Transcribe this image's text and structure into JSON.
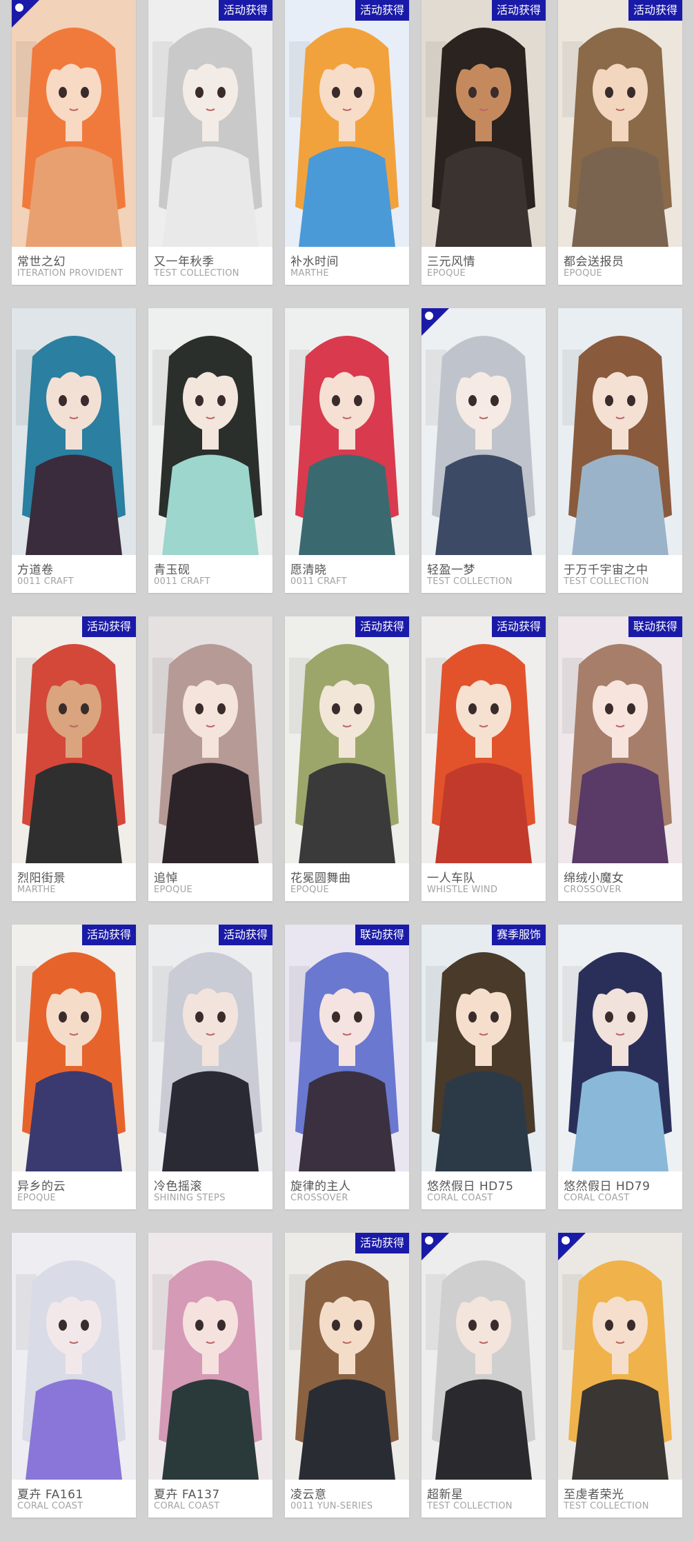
{
  "badges": {
    "event": "活动获得",
    "collab": "联动获得",
    "season": "赛季服饰"
  },
  "rows": [
    [
      {
        "name": "常世之幻",
        "series": "ITERATION PROVIDENT",
        "badge": "",
        "corner": true,
        "bg": "#f2d2b8",
        "hair": "#f07a3c",
        "skin": "#f7d9c4",
        "cloth": "#e8a070"
      },
      {
        "name": "又一年秋季",
        "series": "TEST COLLECTION",
        "badge": "活动获得",
        "corner": false,
        "bg": "#eeeeee",
        "hair": "#c9c9c9",
        "skin": "#f3ece6",
        "cloth": "#e9e9e9"
      },
      {
        "name": "补水时间",
        "series": "MARTHE",
        "badge": "活动获得",
        "corner": false,
        "bg": "#e7eef7",
        "hair": "#f2a23c",
        "skin": "#f7dcc8",
        "cloth": "#4a9ad8"
      },
      {
        "name": "三元风情",
        "series": "EPOQUE",
        "badge": "活动获得",
        "corner": false,
        "bg": "#e2dbd2",
        "hair": "#2a231f",
        "skin": "#c48a5e",
        "cloth": "#3a3330"
      },
      {
        "name": "都会送报员",
        "series": "EPOQUE",
        "badge": "活动获得",
        "corner": false,
        "bg": "#ece6dd",
        "hair": "#8a6a48",
        "skin": "#f2d6bd",
        "cloth": "#7a6450"
      }
    ],
    [
      {
        "name": "方道卷",
        "series": "0011 CRAFT",
        "badge": "",
        "corner": false,
        "bg": "#dfe5e8",
        "hair": "#2b7fa0",
        "skin": "#f3e0d4",
        "cloth": "#3a2c3c"
      },
      {
        "name": "青玉砚",
        "series": "0011 CRAFT",
        "badge": "",
        "corner": false,
        "bg": "#eef0ef",
        "hair": "#2a2f2c",
        "skin": "#f3e6dc",
        "cloth": "#9cd6cc"
      },
      {
        "name": "愿清晓",
        "series": "0011 CRAFT",
        "badge": "",
        "corner": false,
        "bg": "#eef0ef",
        "hair": "#d93a4e",
        "skin": "#f6e0d3",
        "cloth": "#3a6a70"
      },
      {
        "name": "轻盈一梦",
        "series": "TEST COLLECTION",
        "badge": "",
        "corner": true,
        "bg": "#edf0f2",
        "hair": "#bfc4cc",
        "skin": "#f5ebe4",
        "cloth": "#3d4a66"
      },
      {
        "name": "于万千宇宙之中",
        "series": "TEST COLLECTION",
        "badge": "",
        "corner": false,
        "bg": "#e9eef2",
        "hair": "#8a5a3c",
        "skin": "#f4e1d4",
        "cloth": "#9bb3c8"
      }
    ],
    [
      {
        "name": "烈阳街景",
        "series": "MARTHE",
        "badge": "活动获得",
        "corner": false,
        "bg": "#f1eeea",
        "hair": "#d4483a",
        "skin": "#d9a47e",
        "cloth": "#2f2f2f"
      },
      {
        "name": "追悼",
        "series": "EPOQUE",
        "badge": "",
        "corner": false,
        "bg": "#e5e1e0",
        "hair": "#b69a96",
        "skin": "#f4e4dc",
        "cloth": "#2c2428"
      },
      {
        "name": "花冕圆舞曲",
        "series": "EPOQUE",
        "badge": "活动获得",
        "corner": false,
        "bg": "#eeeeea",
        "hair": "#9ca66a",
        "skin": "#f2e6d8",
        "cloth": "#3a3a3a"
      },
      {
        "name": "一人车队",
        "series": "WHISTLE WIND",
        "badge": "活动获得",
        "corner": false,
        "bg": "#f0eeec",
        "hair": "#e2532c",
        "skin": "#f6e1d0",
        "cloth": "#c23a2c"
      },
      {
        "name": "绵绒小魔女",
        "series": "CROSSOVER",
        "badge": "联动获得",
        "corner": false,
        "bg": "#efe7ea",
        "hair": "#a67e6a",
        "skin": "#f7e4dc",
        "cloth": "#5a3a66"
      }
    ],
    [
      {
        "name": "异乡的云",
        "series": "EPOQUE",
        "badge": "活动获得",
        "corner": false,
        "bg": "#f0efec",
        "hair": "#e6642c",
        "skin": "#f5dcc8",
        "cloth": "#3a3a70"
      },
      {
        "name": "冷色摇滚",
        "series": "SHINING STEPS",
        "badge": "活动获得",
        "corner": false,
        "bg": "#ecedef",
        "hair": "#c9ccd4",
        "skin": "#f2e4dc",
        "cloth": "#2a2a34"
      },
      {
        "name": "旋律的主人",
        "series": "CROSSOVER",
        "badge": "联动获得",
        "corner": false,
        "bg": "#e9e6f2",
        "hair": "#6a78d0",
        "skin": "#f4e3e0",
        "cloth": "#3a3040"
      },
      {
        "name": "悠然假日 HD75",
        "series": "CORAL COAST",
        "badge": "赛季服饰",
        "corner": false,
        "bg": "#e6ecf0",
        "hair": "#4a3a2a",
        "skin": "#f5dfcc",
        "cloth": "#2c3a48"
      },
      {
        "name": "悠然假日 HD79",
        "series": "CORAL COAST",
        "badge": "",
        "corner": false,
        "bg": "#eef1f3",
        "hair": "#2a2f5a",
        "skin": "#f2e2dc",
        "cloth": "#8ab8d8"
      }
    ],
    [
      {
        "name": "夏卉 FA161",
        "series": "CORAL COAST",
        "badge": "",
        "corner": false,
        "bg": "#eeedf2",
        "hair": "#d9dbe6",
        "skin": "#f2e8ea",
        "cloth": "#8a76d8"
      },
      {
        "name": "夏卉 FA137",
        "series": "CORAL COAST",
        "badge": "",
        "corner": false,
        "bg": "#efe8ea",
        "hair": "#d49ab6",
        "skin": "#f5e2de",
        "cloth": "#2a3a3a"
      },
      {
        "name": "凌云意",
        "series": "0011 YUN-SERIES",
        "badge": "活动获得",
        "corner": false,
        "bg": "#ecebe8",
        "hair": "#8a6242",
        "skin": "#f4ddc8",
        "cloth": "#2a2c34"
      },
      {
        "name": "超新星",
        "series": "TEST COLLECTION",
        "badge": "",
        "corner": true,
        "bg": "#ededee",
        "hair": "#cfcfcf",
        "skin": "#f3e4dc",
        "cloth": "#2a2a2e"
      },
      {
        "name": "至虔者荣光",
        "series": "TEST COLLECTION",
        "badge": "",
        "corner": true,
        "bg": "#ebe8e4",
        "hair": "#f0b24a",
        "skin": "#f5dfcc",
        "cloth": "#3a3634"
      }
    ]
  ]
}
